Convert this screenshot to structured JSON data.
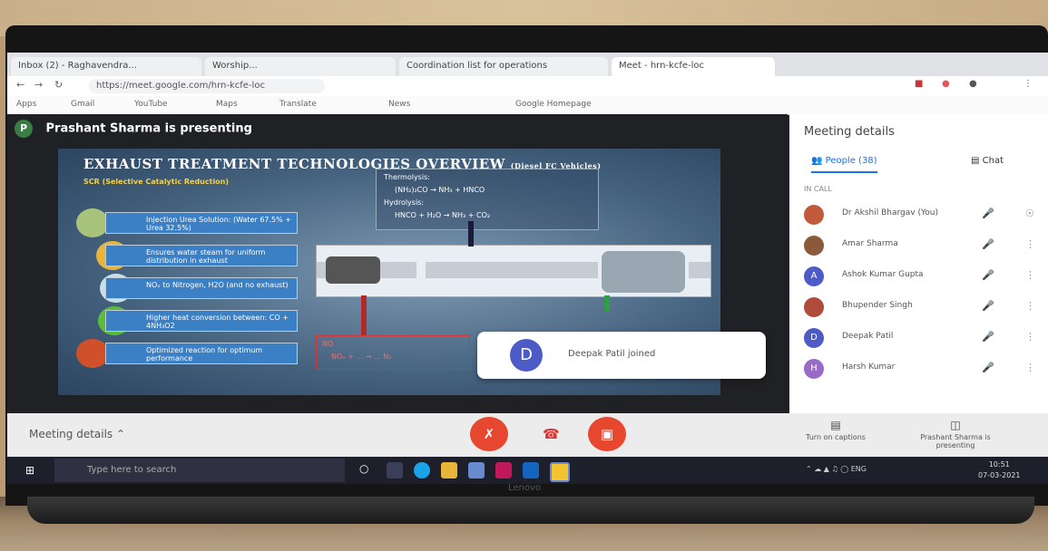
{
  "browser": {
    "tabs": [
      {
        "label": "Inbox (2) - Raghavendra..."
      },
      {
        "label": "Worship..."
      },
      {
        "label": "Coordination list for operations"
      },
      {
        "label": "Meet - hrn-kcfe-loc"
      }
    ],
    "url": "https://meet.google.com/hrn-kcfe-loc",
    "bookmarks": [
      "Apps",
      "Gmail",
      "YouTube",
      "Maps",
      "Translate",
      "News",
      "Google Homepage"
    ]
  },
  "presenter": {
    "initial": "P",
    "label": "Prashant Sharma is presenting"
  },
  "slide": {
    "title": "EXHAUST TREATMENT TECHNOLOGIES OVERVIEW",
    "title_note": "(Diesel FC Vehicles)",
    "subtitle": "SCR (Selective Catalytic Reduction)",
    "chem_lines": [
      "Thermolysis:",
      "(NH₂)₂CO → NH₃ + HNCO",
      "Hydrolysis:",
      "HNCO + H₂O → NH₃ + CO₂"
    ],
    "steps": [
      "Injection Urea Solution: (Water 67.5% + Urea 32.5%)",
      "Ensures water steam for uniform distribution in exhaust",
      "NOₓ to Nitrogen, H2O (and no exhaust)",
      "Higher heat conversion between: CO + 4NH₃O2",
      "Optimized reaction for optimum performance"
    ],
    "red_box_lines": [
      "NO",
      "NOₓ + ... → ... N₂"
    ]
  },
  "toast": {
    "initial": "D",
    "text": "Deepak Patil joined"
  },
  "panel": {
    "title": "Meeting details",
    "tab_people": "People (38)",
    "tab_chat": "Chat",
    "count": "IN CALL",
    "people": [
      {
        "name": "Dr Akshil Bhargav (You)",
        "color": "#c05a3a",
        "initial": ""
      },
      {
        "name": "Amar Sharma",
        "color": "#8a5a3a",
        "initial": ""
      },
      {
        "name": "Ashok Kumar Gupta",
        "color": "#4d5bc7",
        "initial": "A"
      },
      {
        "name": "Bhupender Singh",
        "color": "#b04a3a",
        "initial": ""
      },
      {
        "name": "Deepak Patil",
        "color": "#4d5bc7",
        "initial": "D"
      },
      {
        "name": "Harsh Kumar",
        "color": "#9a6ac7",
        "initial": "H"
      }
    ]
  },
  "bottom": {
    "meeting_details": "Meeting details",
    "captions": "Turn on captions",
    "presenting": "Prashant Sharma is presenting"
  },
  "taskbar": {
    "search_placeholder": "Type here to search",
    "time": "10:51",
    "date": "07-03-2021",
    "lang": "ENG"
  },
  "device": {
    "brand": "Lenovo"
  }
}
